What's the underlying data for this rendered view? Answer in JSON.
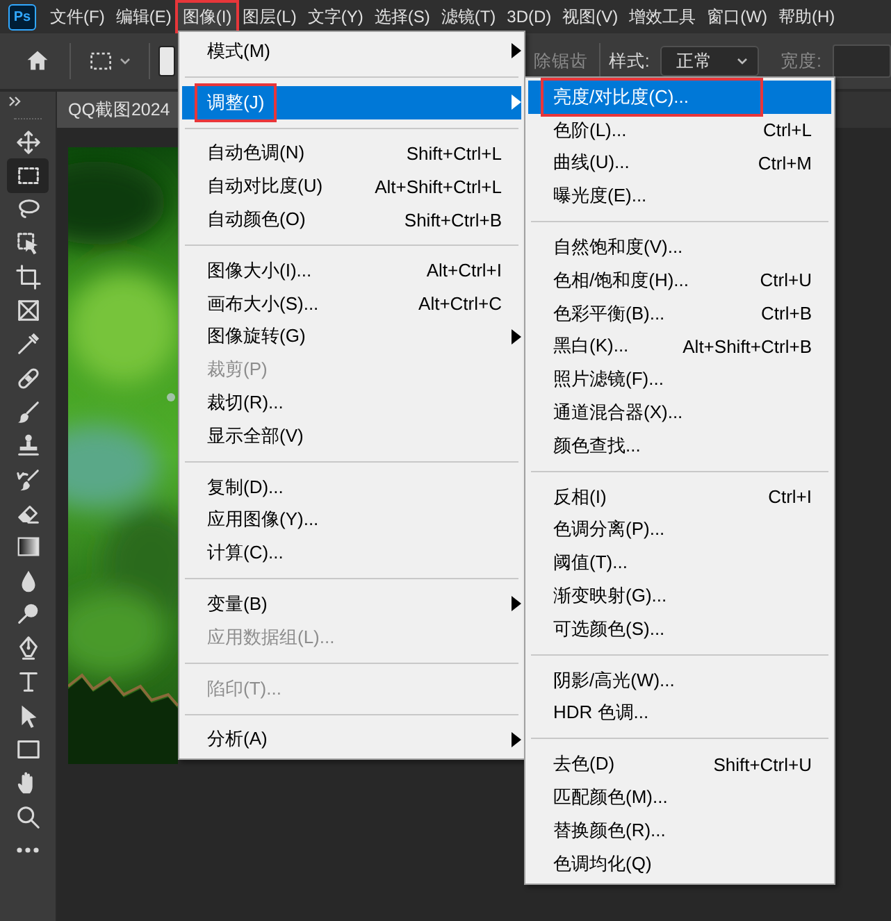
{
  "menubar": {
    "logo": "Ps",
    "items": [
      {
        "label": "文件(F)",
        "selected": false,
        "annotated": false
      },
      {
        "label": "编辑(E)",
        "selected": false,
        "annotated": false
      },
      {
        "label": "图像(I)",
        "selected": true,
        "annotated": true
      },
      {
        "label": "图层(L)",
        "selected": false,
        "annotated": false
      },
      {
        "label": "文字(Y)",
        "selected": false,
        "annotated": false
      },
      {
        "label": "选择(S)",
        "selected": false,
        "annotated": false
      },
      {
        "label": "滤镜(T)",
        "selected": false,
        "annotated": false
      },
      {
        "label": "3D(D)",
        "selected": false,
        "annotated": false
      },
      {
        "label": "视图(V)",
        "selected": false,
        "annotated": false
      },
      {
        "label": "增效工具",
        "selected": false,
        "annotated": false
      },
      {
        "label": "窗口(W)",
        "selected": false,
        "annotated": false
      },
      {
        "label": "帮助(H)",
        "selected": false,
        "annotated": false
      }
    ]
  },
  "options_bar": {
    "antialias_label": "除锯齿",
    "antialias_disabled": true,
    "style_label": "样式:",
    "style_value": "正常",
    "width_label": "宽度:",
    "width_disabled": true
  },
  "document_tab": {
    "title": "QQ截图2024"
  },
  "tools": [
    {
      "selected": false
    },
    {
      "selected": true
    },
    {
      "selected": false
    },
    {
      "selected": false
    },
    {
      "selected": false
    },
    {
      "selected": false
    },
    {
      "selected": false
    },
    {
      "selected": false
    },
    {
      "selected": false
    },
    {
      "selected": false
    },
    {
      "selected": false
    },
    {
      "selected": false
    },
    {
      "selected": false
    },
    {
      "selected": false
    },
    {
      "selected": false
    },
    {
      "selected": false
    },
    {
      "selected": false
    },
    {
      "selected": false
    },
    {
      "selected": false
    },
    {
      "selected": false
    },
    {
      "selected": false
    },
    {
      "selected": false
    }
  ],
  "image_menu": {
    "items": [
      {
        "kind": "item",
        "label": "模式(M)",
        "submenu": true,
        "disabled": false,
        "selected": false,
        "annotated": false
      },
      {
        "kind": "separator"
      },
      {
        "kind": "item",
        "label": "调整(J)",
        "submenu": true,
        "disabled": false,
        "selected": true,
        "annotated": true
      },
      {
        "kind": "separator"
      },
      {
        "kind": "item",
        "label": "自动色调(N)",
        "shortcut": "Shift+Ctrl+L",
        "submenu": false,
        "disabled": false,
        "selected": false,
        "annotated": false
      },
      {
        "kind": "item",
        "label": "自动对比度(U)",
        "shortcut": "Alt+Shift+Ctrl+L",
        "submenu": false,
        "disabled": false,
        "selected": false,
        "annotated": false
      },
      {
        "kind": "item",
        "label": "自动颜色(O)",
        "shortcut": "Shift+Ctrl+B",
        "submenu": false,
        "disabled": false,
        "selected": false,
        "annotated": false
      },
      {
        "kind": "separator"
      },
      {
        "kind": "item",
        "label": "图像大小(I)...",
        "shortcut": "Alt+Ctrl+I",
        "submenu": false,
        "disabled": false,
        "selected": false,
        "annotated": false
      },
      {
        "kind": "item",
        "label": "画布大小(S)...",
        "shortcut": "Alt+Ctrl+C",
        "submenu": false,
        "disabled": false,
        "selected": false,
        "annotated": false
      },
      {
        "kind": "item",
        "label": "图像旋转(G)",
        "submenu": true,
        "disabled": false,
        "selected": false,
        "annotated": false
      },
      {
        "kind": "item",
        "label": "裁剪(P)",
        "submenu": false,
        "disabled": true,
        "selected": false,
        "annotated": false
      },
      {
        "kind": "item",
        "label": "裁切(R)...",
        "submenu": false,
        "disabled": false,
        "selected": false,
        "annotated": false
      },
      {
        "kind": "item",
        "label": "显示全部(V)",
        "submenu": false,
        "disabled": false,
        "selected": false,
        "annotated": false
      },
      {
        "kind": "separator"
      },
      {
        "kind": "item",
        "label": "复制(D)...",
        "submenu": false,
        "disabled": false,
        "selected": false,
        "annotated": false
      },
      {
        "kind": "item",
        "label": "应用图像(Y)...",
        "submenu": false,
        "disabled": false,
        "selected": false,
        "annotated": false
      },
      {
        "kind": "item",
        "label": "计算(C)...",
        "submenu": false,
        "disabled": false,
        "selected": false,
        "annotated": false
      },
      {
        "kind": "separator"
      },
      {
        "kind": "item",
        "label": "变量(B)",
        "submenu": true,
        "disabled": false,
        "selected": false,
        "annotated": false
      },
      {
        "kind": "item",
        "label": "应用数据组(L)...",
        "submenu": false,
        "disabled": true,
        "selected": false,
        "annotated": false
      },
      {
        "kind": "separator"
      },
      {
        "kind": "item",
        "label": "陷印(T)...",
        "submenu": false,
        "disabled": true,
        "selected": false,
        "annotated": false
      },
      {
        "kind": "separator"
      },
      {
        "kind": "item",
        "label": "分析(A)",
        "submenu": true,
        "disabled": false,
        "selected": false,
        "annotated": false
      }
    ]
  },
  "adjustments_menu": {
    "items": [
      {
        "kind": "item",
        "label": "亮度/对比度(C)...",
        "submenu": false,
        "disabled": false,
        "selected": true,
        "annotated": true
      },
      {
        "kind": "item",
        "label": "色阶(L)...",
        "shortcut": "Ctrl+L",
        "submenu": false,
        "disabled": false,
        "selected": false,
        "annotated": false
      },
      {
        "kind": "item",
        "label": "曲线(U)...",
        "shortcut": "Ctrl+M",
        "submenu": false,
        "disabled": false,
        "selected": false,
        "annotated": false
      },
      {
        "kind": "item",
        "label": "曝光度(E)...",
        "submenu": false,
        "disabled": false,
        "selected": false,
        "annotated": false
      },
      {
        "kind": "separator"
      },
      {
        "kind": "item",
        "label": "自然饱和度(V)...",
        "submenu": false,
        "disabled": false,
        "selected": false,
        "annotated": false
      },
      {
        "kind": "item",
        "label": "色相/饱和度(H)...",
        "shortcut": "Ctrl+U",
        "submenu": false,
        "disabled": false,
        "selected": false,
        "annotated": false
      },
      {
        "kind": "item",
        "label": "色彩平衡(B)...",
        "shortcut": "Ctrl+B",
        "submenu": false,
        "disabled": false,
        "selected": false,
        "annotated": false
      },
      {
        "kind": "item",
        "label": "黑白(K)...",
        "shortcut": "Alt+Shift+Ctrl+B",
        "submenu": false,
        "disabled": false,
        "selected": false,
        "annotated": false
      },
      {
        "kind": "item",
        "label": "照片滤镜(F)...",
        "submenu": false,
        "disabled": false,
        "selected": false,
        "annotated": false
      },
      {
        "kind": "item",
        "label": "通道混合器(X)...",
        "submenu": false,
        "disabled": false,
        "selected": false,
        "annotated": false
      },
      {
        "kind": "item",
        "label": "颜色查找...",
        "submenu": false,
        "disabled": false,
        "selected": false,
        "annotated": false
      },
      {
        "kind": "separator"
      },
      {
        "kind": "item",
        "label": "反相(I)",
        "shortcut": "Ctrl+I",
        "submenu": false,
        "disabled": false,
        "selected": false,
        "annotated": false
      },
      {
        "kind": "item",
        "label": "色调分离(P)...",
        "submenu": false,
        "disabled": false,
        "selected": false,
        "annotated": false
      },
      {
        "kind": "item",
        "label": "阈值(T)...",
        "submenu": false,
        "disabled": false,
        "selected": false,
        "annotated": false
      },
      {
        "kind": "item",
        "label": "渐变映射(G)...",
        "submenu": false,
        "disabled": false,
        "selected": false,
        "annotated": false
      },
      {
        "kind": "item",
        "label": "可选颜色(S)...",
        "submenu": false,
        "disabled": false,
        "selected": false,
        "annotated": false
      },
      {
        "kind": "separator"
      },
      {
        "kind": "item",
        "label": "阴影/高光(W)...",
        "submenu": false,
        "disabled": false,
        "selected": false,
        "annotated": false
      },
      {
        "kind": "item",
        "label": "HDR 色调...",
        "submenu": false,
        "disabled": false,
        "selected": false,
        "annotated": false
      },
      {
        "kind": "separator"
      },
      {
        "kind": "item",
        "label": "去色(D)",
        "shortcut": "Shift+Ctrl+U",
        "submenu": false,
        "disabled": false,
        "selected": false,
        "annotated": false
      },
      {
        "kind": "item",
        "label": "匹配颜色(M)...",
        "submenu": false,
        "disabled": false,
        "selected": false,
        "annotated": false
      },
      {
        "kind": "item",
        "label": "替换颜色(R)...",
        "submenu": false,
        "disabled": false,
        "selected": false,
        "annotated": false
      },
      {
        "kind": "item",
        "label": "色调均化(Q)",
        "submenu": false,
        "disabled": false,
        "selected": false,
        "annotated": false
      }
    ]
  }
}
